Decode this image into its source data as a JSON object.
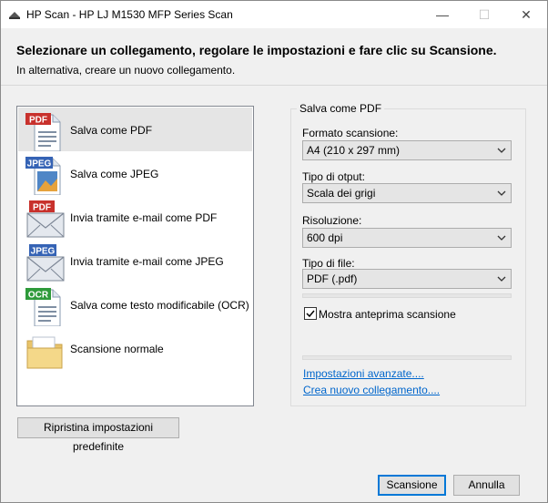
{
  "window": {
    "title": "HP Scan - HP LJ M1530 MFP Series Scan",
    "controls": {
      "minimize": "—",
      "maximize": "☐",
      "close": "✕"
    }
  },
  "header": {
    "heading": "Selezionare un collegamento, regolare le impostazioni e fare clic su Scansione.",
    "subheading": "In alternativa, creare un nuovo collegamento."
  },
  "shortcuts": {
    "items": [
      {
        "label": "Salva come PDF",
        "icon": "pdf-document-icon",
        "badge": "PDF",
        "badge_color": "#c8312c"
      },
      {
        "label": "Salva come JPEG",
        "icon": "jpeg-image-icon",
        "badge": "JPEG",
        "badge_color": "#3563b5"
      },
      {
        "label": "Invia tramite e-mail come PDF",
        "icon": "email-pdf-icon",
        "badge": "PDF",
        "badge_color": "#c8312c"
      },
      {
        "label": "Invia tramite e-mail come JPEG",
        "icon": "email-jpeg-icon",
        "badge": "JPEG",
        "badge_color": "#3563b5"
      },
      {
        "label": "Salva come testo modificabile (OCR)",
        "icon": "ocr-document-icon",
        "badge": "OCR",
        "badge_color": "#2e9a3a"
      },
      {
        "label": "Scansione normale",
        "icon": "folder-icon",
        "badge": "",
        "badge_color": ""
      }
    ],
    "selected_index": 0
  },
  "reset_button": "Ripristina impostazioni predefinite",
  "settings": {
    "group_title": "Salva come PDF",
    "scan_format": {
      "label": "Formato scansione:",
      "value": "A4 (210 x 297 mm)"
    },
    "output_type": {
      "label": "Tipo di otput:",
      "value": "Scala dei grigi"
    },
    "resolution": {
      "label": "Risoluzione:",
      "value": "600 dpi"
    },
    "file_type": {
      "label": "Tipo di file:",
      "value": "PDF (.pdf)"
    },
    "preview": {
      "label": "Mostra anteprima scansione",
      "checked": true
    },
    "advanced_link": "Impostazioni avanzate....",
    "new_shortcut_link": "Crea nuovo collegamento...."
  },
  "buttons": {
    "scan": "Scansione",
    "cancel": "Annulla"
  },
  "colors": {
    "accent": "#0078d7",
    "link": "#0066cc",
    "selection": "#e5e5e5"
  }
}
